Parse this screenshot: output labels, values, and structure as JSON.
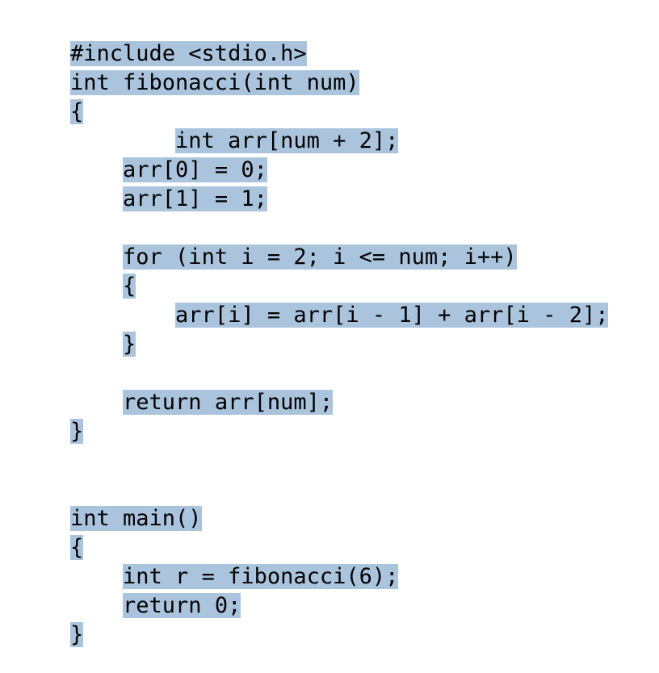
{
  "document": {
    "kind": "code-snippet",
    "language": "C",
    "background_color": "#ffffff",
    "text_color": "#000000",
    "highlight_color": "#a9c4dc"
  },
  "code": {
    "lines": [
      {
        "text": "#include <stdio.h>",
        "highlighted": true
      },
      {
        "text": "int fibonacci(int num)",
        "highlighted": true
      },
      {
        "text": "{",
        "highlighted": true
      },
      {
        "text": "        int arr[num + 2];",
        "highlighted": true
      },
      {
        "text": "    arr[0] = 0;",
        "highlighted": true
      },
      {
        "text": "    arr[1] = 1;",
        "highlighted": true
      },
      {
        "text": "",
        "highlighted": false
      },
      {
        "text": "    for (int i = 2; i <= num; i++)",
        "highlighted": true
      },
      {
        "text": "    {",
        "highlighted": true
      },
      {
        "text": "        arr[i] = arr[i - 1] + arr[i - 2];",
        "highlighted": true
      },
      {
        "text": "    }",
        "highlighted": true
      },
      {
        "text": "",
        "highlighted": false
      },
      {
        "text": "    return arr[num];",
        "highlighted": true
      },
      {
        "text": "}",
        "highlighted": true
      },
      {
        "text": "",
        "highlighted": false
      },
      {
        "text": "",
        "highlighted": false
      },
      {
        "text": "int main()",
        "highlighted": true
      },
      {
        "text": "{",
        "highlighted": true
      },
      {
        "text": "    int r = fibonacci(6);",
        "highlighted": true
      },
      {
        "text": "    return 0;",
        "highlighted": true
      },
      {
        "text": "}",
        "highlighted": true
      }
    ]
  }
}
